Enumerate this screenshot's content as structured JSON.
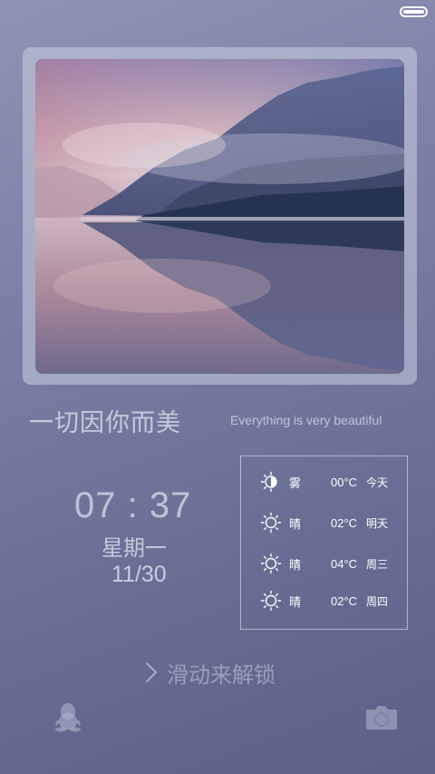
{
  "status_bar": {
    "battery_icon": "battery-full-icon"
  },
  "wallpaper_photo": {
    "description_icon": "mountain-lake-photo"
  },
  "motto": {
    "chinese": "一切因你而美",
    "english": "Everything is very beautiful"
  },
  "clock": {
    "time": "07 : 37",
    "weekday": "星期一",
    "date": "11/30"
  },
  "weather": [
    {
      "icon": "fog-icon",
      "condition": "雾",
      "temp": "00°C",
      "day": "今天"
    },
    {
      "icon": "sun-icon",
      "condition": "晴",
      "temp": "02°C",
      "day": "明天"
    },
    {
      "icon": "sun-icon",
      "condition": "晴",
      "temp": "04°C",
      "day": "周三"
    },
    {
      "icon": "sun-icon",
      "condition": "晴",
      "temp": "02°C",
      "day": "周四"
    }
  ],
  "unlock": {
    "label": "滑动来解锁",
    "icon": "chevron-right-icon"
  },
  "shortcuts": {
    "left_icon": "qq-penguin-icon",
    "right_icon": "camera-icon"
  },
  "colors": {
    "background_top": "#8f94b6",
    "background_bottom": "#5b6088"
  }
}
